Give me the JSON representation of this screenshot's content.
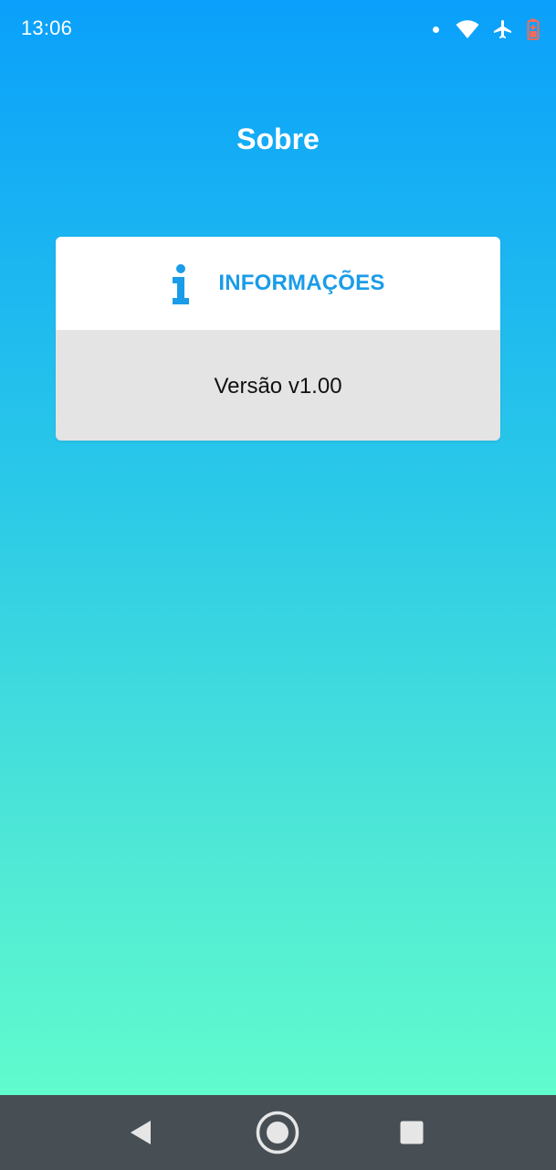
{
  "status_bar": {
    "time": "13:06",
    "icons": [
      "notification-dot-icon",
      "wifi-icon",
      "airplane-mode-icon",
      "battery-icon"
    ]
  },
  "page": {
    "title": "Sobre"
  },
  "info_card": {
    "icon": "info-icon",
    "header_label": "INFORMAÇÕES",
    "version_text": "Versão v1.00"
  },
  "nav_bar": {
    "buttons": [
      "back-icon",
      "home-icon",
      "recents-icon"
    ]
  },
  "colors": {
    "gradient_top": "#0aa0fb",
    "gradient_bottom": "#60fccd",
    "accent": "#1a9ce8",
    "card_body_bg": "#e4e4e4",
    "nav_bar_bg": "#474f55"
  }
}
